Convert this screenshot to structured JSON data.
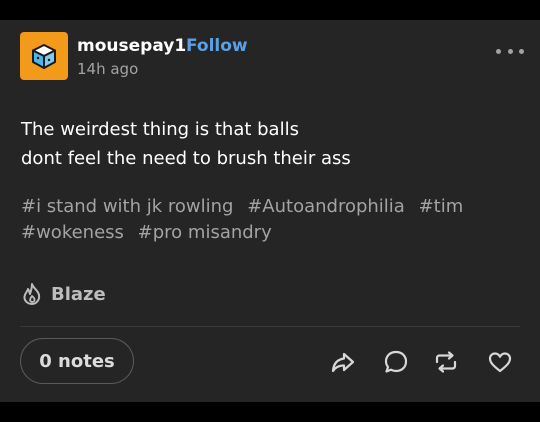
{
  "post": {
    "username": "mousepay1",
    "follow_label": "Follow",
    "timestamp": "14h ago",
    "body_lines": [
      "The weirdest thing is that balls",
      "dont feel the need to brush their ass"
    ],
    "tags": [
      "#i stand with jk rowling",
      "#Autoandrophilia",
      "#tim",
      "#wokeness",
      "#pro misandry"
    ],
    "blaze_label": "Blaze",
    "notes_label": "0 notes"
  },
  "icons": {
    "avatar": "cube-icon",
    "more": "more-options-icon",
    "blaze": "flame-icon",
    "share": "share-icon",
    "reply": "reply-icon",
    "reblog": "reblog-icon",
    "like": "heart-icon"
  },
  "colors": {
    "background": "#252525",
    "accent": "#5aa0e6",
    "avatar": "#f39a1a",
    "muted_text": "#a3a3a3"
  }
}
